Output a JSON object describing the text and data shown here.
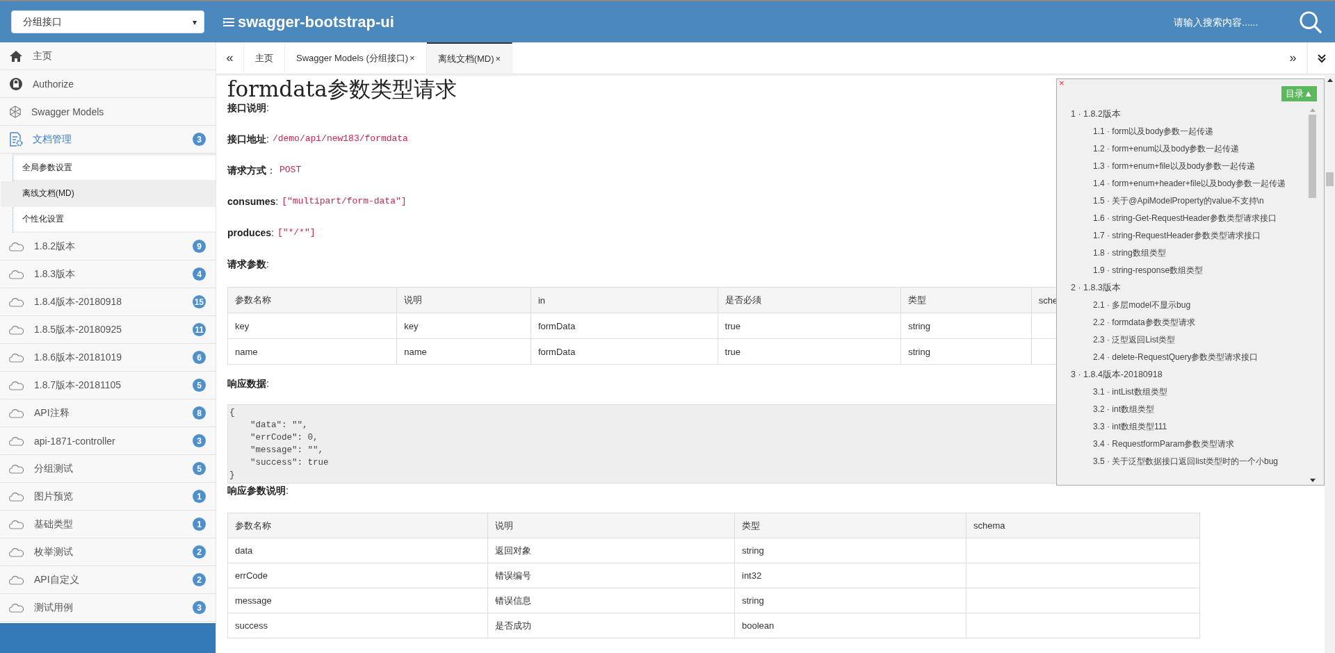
{
  "header": {
    "group_select": {
      "value": "分组接口",
      "caret": "▾"
    },
    "logo": "swagger-bootstrap-ui",
    "search": {
      "placeholder": "请输入搜索内容......"
    }
  },
  "sidebar": {
    "items": [
      {
        "kind": "home",
        "label": "主页",
        "selected": false
      },
      {
        "kind": "lock",
        "label": "Authorize",
        "selected": false
      },
      {
        "kind": "models",
        "label": "Swagger Models",
        "selected": false
      },
      {
        "kind": "docs",
        "label": "文档管理",
        "badge": "3",
        "selected": false,
        "expanded": true,
        "children": [
          {
            "label": "全局参数设置",
            "selected": false
          },
          {
            "label": "离线文档(MD)",
            "selected": true
          },
          {
            "label": "个性化设置",
            "selected": false
          }
        ]
      },
      {
        "kind": "api",
        "label": "1.8.2版本",
        "badge": "9",
        "selected": false
      },
      {
        "kind": "api",
        "label": "1.8.3版本",
        "badge": "4",
        "selected": false
      },
      {
        "kind": "api",
        "label": "1.8.4版本-20180918",
        "badge": "15",
        "selected": false
      },
      {
        "kind": "api",
        "label": "1.8.5版本-20180925",
        "badge": "11",
        "selected": false
      },
      {
        "kind": "api",
        "label": "1.8.6版本-20181019",
        "badge": "6",
        "selected": false
      },
      {
        "kind": "api",
        "label": "1.8.7版本-20181105",
        "badge": "5",
        "selected": false
      },
      {
        "kind": "api",
        "label": "API注释",
        "badge": "8",
        "selected": false
      },
      {
        "kind": "api",
        "label": "api-1871-controller",
        "badge": "3",
        "selected": false
      },
      {
        "kind": "api",
        "label": "分组测试",
        "badge": "5",
        "selected": false
      },
      {
        "kind": "api",
        "label": "图片预览",
        "badge": "1",
        "selected": false
      },
      {
        "kind": "api",
        "label": "基础类型",
        "badge": "1",
        "selected": false
      },
      {
        "kind": "api",
        "label": "枚举测试",
        "badge": "2",
        "selected": false
      },
      {
        "kind": "api",
        "label": "API自定义",
        "badge": "2",
        "selected": false
      },
      {
        "kind": "api",
        "label": "测试用例",
        "badge": "3",
        "selected": false
      }
    ]
  },
  "tabs": {
    "prev": "«",
    "next": "»",
    "items": [
      {
        "label": "主页",
        "selected": false
      },
      {
        "label": "Swagger Models (分组接口)",
        "close": "×",
        "selected": false
      },
      {
        "label": "离线文档(MD)",
        "close": "×",
        "selected": true
      }
    ]
  },
  "doc": {
    "title": "formdata参数类型请求",
    "fields": [
      {
        "label": "**接口说明**:"
      },
      {
        "label": "**接口地址**:",
        "value": "/demo/api/new183/formdata"
      },
      {
        "label": "**请求方式**：",
        "value": "POST"
      },
      {
        "label": "**consumes**:",
        "value": "[\"multipart/form-data\"]"
      },
      {
        "label": "**produces**:",
        "value": "[\"*/*\"]"
      }
    ],
    "request_heading": "**请求参数**:",
    "request_table": {
      "columns": [
        "参数名称",
        "说明",
        "in",
        "是否必须",
        "类型",
        "sche"
      ],
      "rows": [
        [
          "key",
          "key",
          "formData",
          "true",
          "string",
          ""
        ],
        [
          "name",
          "name",
          "formData",
          "true",
          "string",
          ""
        ]
      ]
    },
    "response_heading": "**响应数据**:",
    "response_code": [
      "{",
      "    \"data\": \"\",",
      "    \"errCode\": 0,",
      "    \"message\": \"\",",
      "    \"success\": true",
      "}"
    ],
    "response_params_heading": "**响应参数说明**:",
    "response_table": {
      "columns": [
        "参数名称",
        "说明",
        "类型",
        "schema"
      ],
      "rows": [
        [
          "data",
          "返回对象",
          "string",
          ""
        ],
        [
          "errCode",
          "错误编号",
          "int32",
          ""
        ],
        [
          "message",
          "错误信息",
          "string",
          ""
        ],
        [
          "success",
          "是否成功",
          "boolean",
          ""
        ]
      ]
    }
  },
  "toc": {
    "close": "×",
    "toggle": "目录▲",
    "separator": "·",
    "items": [
      {
        "number": "1",
        "label": "1.8.2版本",
        "children": [
          {
            "number": "1.1",
            "label": "form以及body参数一起传递"
          },
          {
            "number": "1.2",
            "label": "form+enum以及body参数一起传递"
          },
          {
            "number": "1.3",
            "label": "form+enum+file以及body参数一起传递"
          },
          {
            "number": "1.4",
            "label": "form+enum+header+file以及body参数一起传递"
          },
          {
            "number": "1.5",
            "label": "关于@ApiModelProperty的value不支持\\n"
          },
          {
            "number": "1.6",
            "label": "string-Get-RequestHeader参数类型请求接口"
          },
          {
            "number": "1.7",
            "label": "string-RequestHeader参数类型请求接口"
          },
          {
            "number": "1.8",
            "label": "string数组类型"
          },
          {
            "number": "1.9",
            "label": "string-response数组类型"
          }
        ]
      },
      {
        "number": "2",
        "label": "1.8.3版本",
        "children": [
          {
            "number": "2.1",
            "label": "多层model不显示bug"
          },
          {
            "number": "2.2",
            "label": "formdata参数类型请求"
          },
          {
            "number": "2.3",
            "label": "泛型返回List类型"
          },
          {
            "number": "2.4",
            "label": "delete-RequestQuery参数类型请求接口"
          }
        ]
      },
      {
        "number": "3",
        "label": "1.8.4版本-20180918",
        "children": [
          {
            "number": "3.1",
            "label": "intList数组类型"
          },
          {
            "number": "3.2",
            "label": "int数组类型"
          },
          {
            "number": "3.3",
            "label": "int数组类型111"
          },
          {
            "number": "3.4",
            "label": "RequestformParam参数类型请求"
          },
          {
            "number": "3.5",
            "label": "关于泛型数据接口返回list类型时的一个小bug"
          }
        ]
      }
    ]
  }
}
